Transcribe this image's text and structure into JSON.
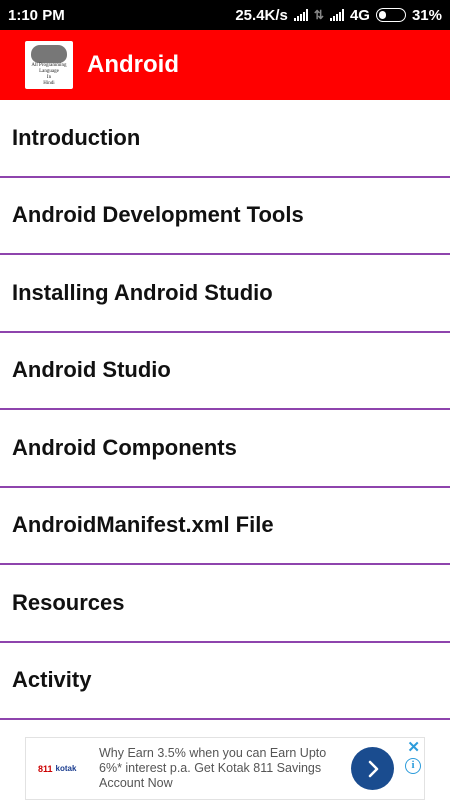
{
  "status_bar": {
    "time": "1:10 PM",
    "speed": "25.4K/s",
    "network": "4G",
    "battery": "31%",
    "battery_level": 0.31
  },
  "app_bar": {
    "title": "Android",
    "logo_text": [
      "All Programming",
      "Language",
      "In",
      "Hindi"
    ],
    "background_color": "#ff0000"
  },
  "topics": [
    {
      "label": "Introduction"
    },
    {
      "label": "Android Development Tools"
    },
    {
      "label": "Installing Android Studio"
    },
    {
      "label": "Android Studio"
    },
    {
      "label": "Android Components"
    },
    {
      "label": "AndroidManifest.xml File"
    },
    {
      "label": "Resources"
    },
    {
      "label": "Activity"
    }
  ],
  "ad": {
    "text": "Why Earn 3.5% when you can Earn Upto 6%* interest p.a. Get Kotak 811 Savings Account Now",
    "brand": "811",
    "brand_sub": "kotak",
    "close_icon": "close-icon",
    "info_icon": "info-icon",
    "accent_color": "#1a4c8f"
  }
}
